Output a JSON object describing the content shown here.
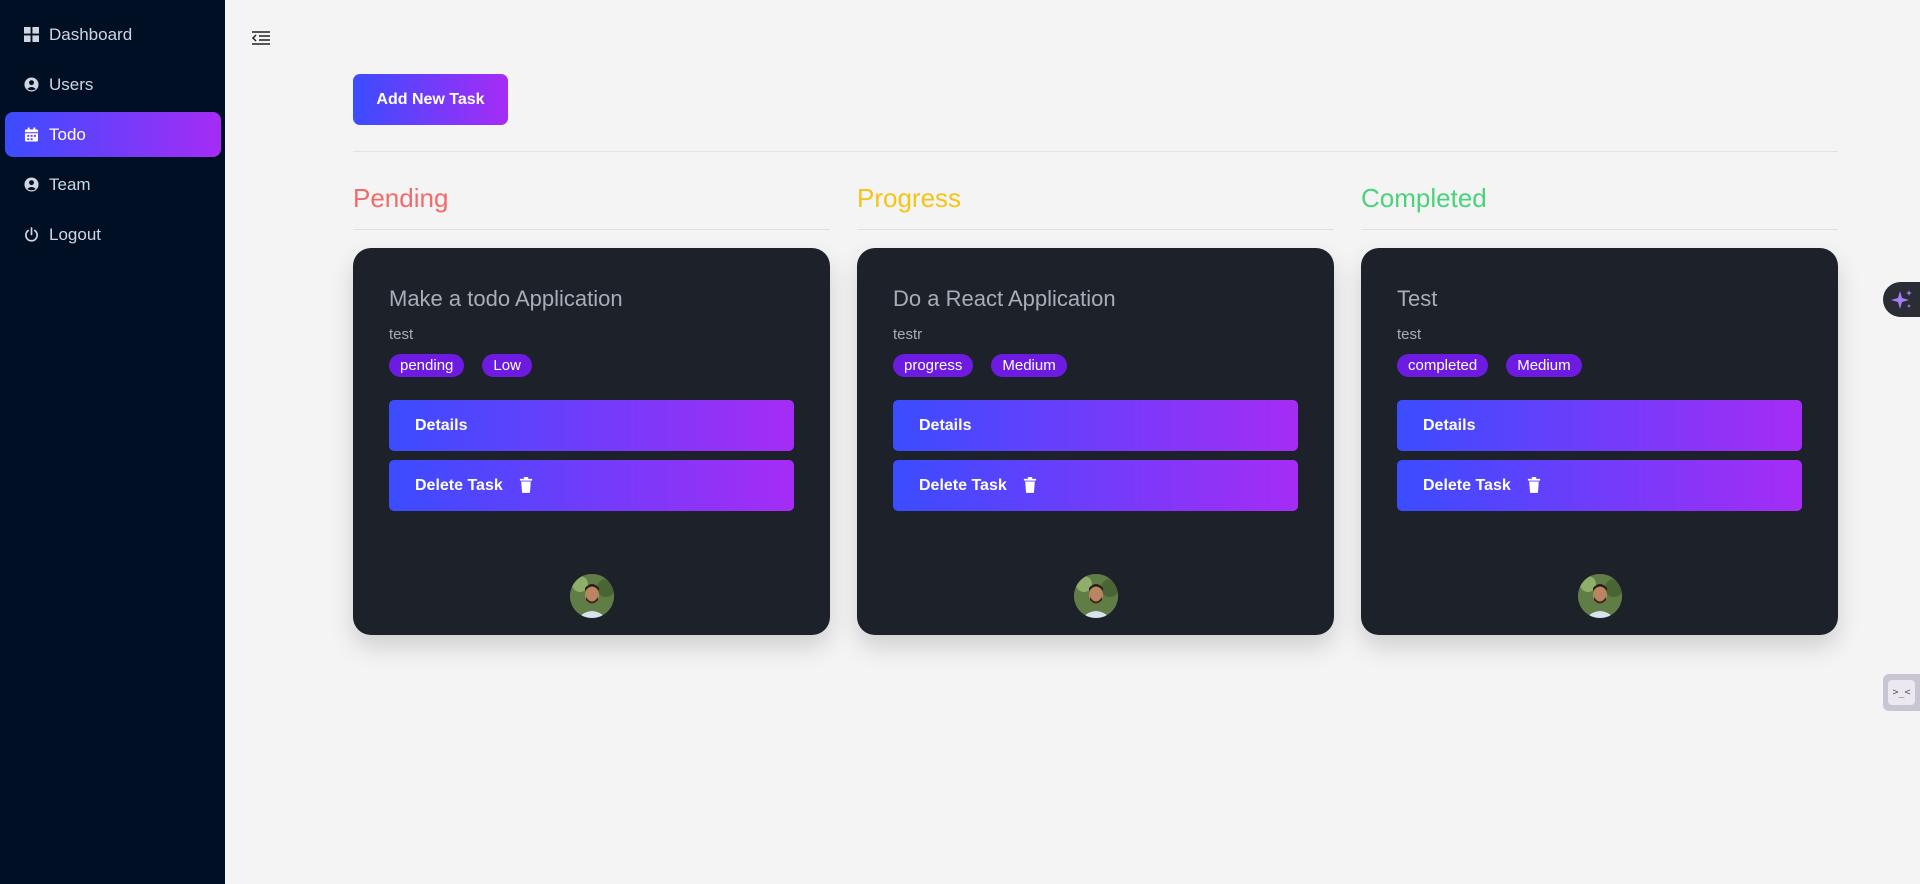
{
  "sidebar": {
    "items": [
      {
        "label": "Dashboard",
        "icon": "grid-icon",
        "active": false
      },
      {
        "label": "Users",
        "icon": "user-circle-icon",
        "active": false
      },
      {
        "label": "Todo",
        "icon": "calendar-icon",
        "active": true
      },
      {
        "label": "Team",
        "icon": "user-circle-icon",
        "active": false
      },
      {
        "label": "Logout",
        "icon": "power-icon",
        "active": false
      }
    ]
  },
  "toolbar": {
    "add_task_label": "Add New Task"
  },
  "columns": [
    {
      "title": "Pending",
      "color": "#f26b6b",
      "cards": [
        {
          "title": "Make a todo Application",
          "description": "test",
          "status": "pending",
          "priority": "Low",
          "details_label": "Details",
          "delete_label": "Delete Task"
        }
      ]
    },
    {
      "title": "Progress",
      "color": "#f4c418",
      "cards": [
        {
          "title": "Do a React Application",
          "description": "testr",
          "status": "progress",
          "priority": "Medium",
          "details_label": "Details",
          "delete_label": "Delete Task"
        }
      ]
    },
    {
      "title": "Completed",
      "color": "#4bd27c",
      "cards": [
        {
          "title": "Test",
          "description": "test",
          "status": "completed",
          "priority": "Medium",
          "details_label": "Details",
          "delete_label": "Delete Task"
        }
      ]
    }
  ],
  "floating": {
    "ai_icon": "sparkle-icon",
    "terminal_label": ">_<"
  },
  "colors": {
    "sidebar_bg": "#010f25",
    "accent_start": "#3b4cff",
    "accent_end": "#a62cf5",
    "card_bg": "#1c212a",
    "badge_bg": "#6d1be0"
  }
}
